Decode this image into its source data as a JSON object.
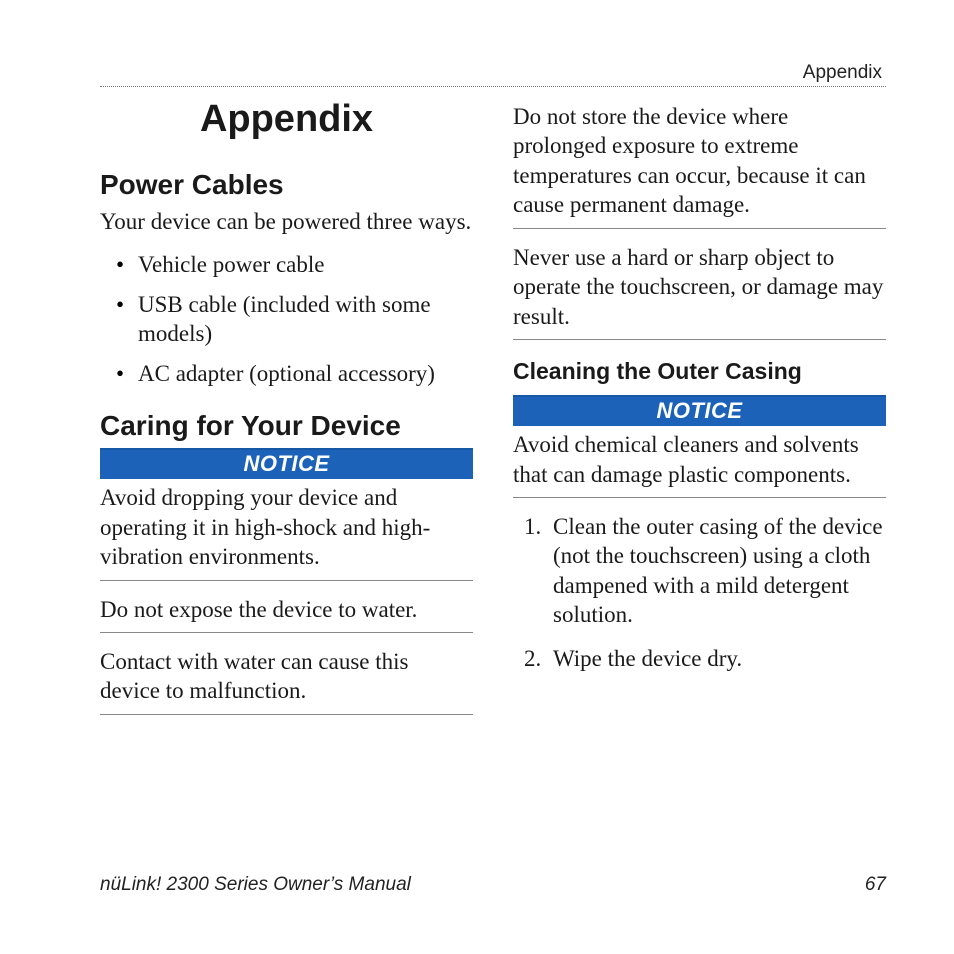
{
  "header": {
    "section": "Appendix"
  },
  "left": {
    "title": "Appendix",
    "s1": {
      "heading": "Power Cables",
      "intro": "Your device can be powered three ways.",
      "bullets": [
        "Vehicle power cable",
        "USB cable (included with some models)",
        "AC adapter (optional accessory)"
      ]
    },
    "s2": {
      "heading": "Caring for Your Device",
      "notice_label": "NOTICE",
      "paras": [
        "Avoid dropping your device and operating it in high-shock and high-vibration environments.",
        "Do not expose the device to water.",
        "Contact with water can cause this device to malfunction."
      ]
    }
  },
  "right": {
    "paras_top": [
      "Do not store the device where prolonged exposure to extreme temperatures can occur, because it can cause permanent damage.",
      "Never use a hard or sharp object to operate the touchscreen, or damage may result."
    ],
    "sub": {
      "heading": "Cleaning the Outer Casing",
      "notice_label": "NOTICE",
      "notice_text": "Avoid chemical cleaners and solvents that can damage plastic components.",
      "steps": [
        "Clean the outer casing of the device (not the touchscreen) using a cloth dampened with a mild detergent solution.",
        "Wipe the device dry."
      ]
    }
  },
  "footer": {
    "manual": "nüLink! 2300 Series Owner’s Manual",
    "page": "67"
  }
}
